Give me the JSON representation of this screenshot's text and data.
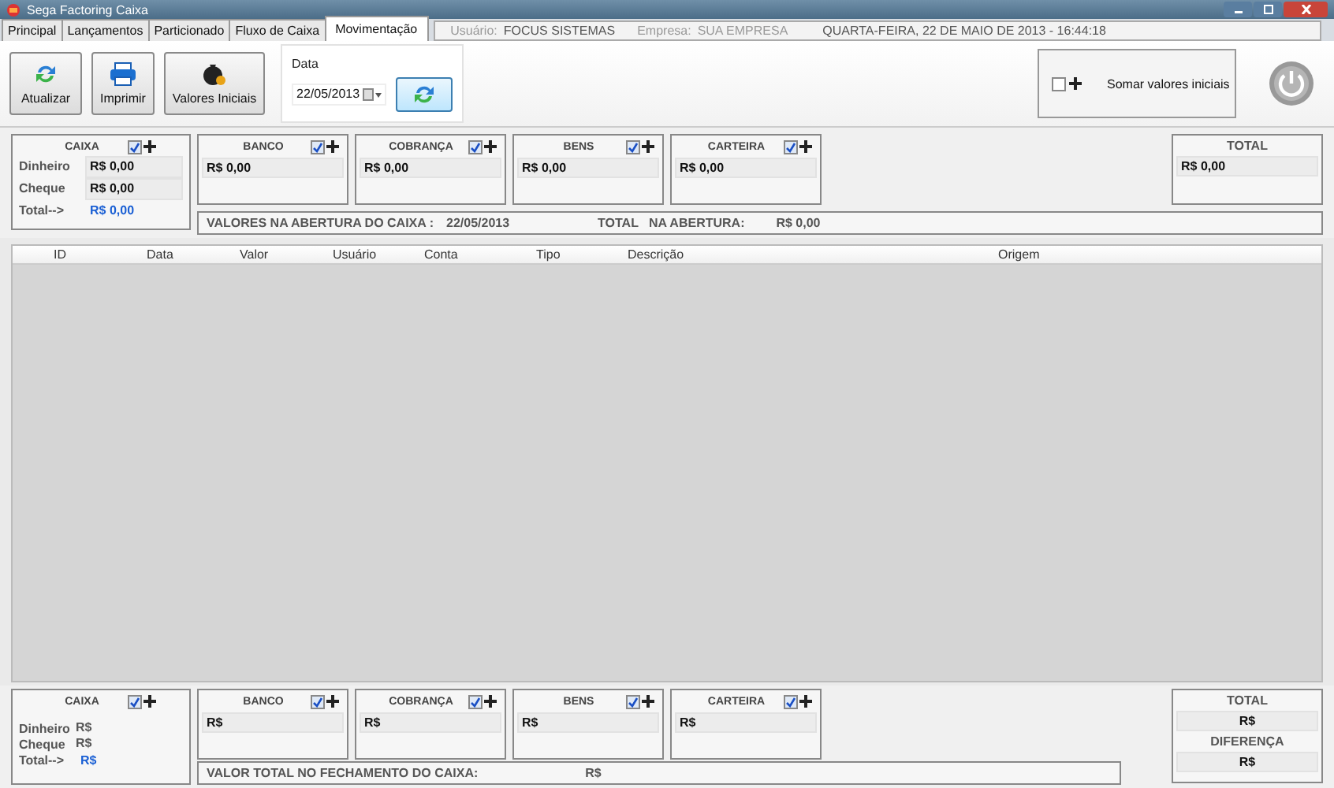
{
  "window": {
    "title": "Sega Factoring Caixa"
  },
  "tabs": [
    {
      "label": "Principal",
      "selected": false
    },
    {
      "label": "Lançamentos",
      "selected": false
    },
    {
      "label": "Particionado",
      "selected": false
    },
    {
      "label": "Fluxo de Caixa",
      "selected": false
    },
    {
      "label": "Movimentação",
      "selected": true
    }
  ],
  "session": {
    "user_label": "Usuário:",
    "user": "FOCUS SISTEMAS",
    "company_label": "Empresa:",
    "company": "SUA EMPRESA",
    "datetime": "QUARTA-FEIRA, 22 DE MAIO DE 2013 - 16:44:18"
  },
  "toolbar": [
    {
      "kind": "refresh",
      "label": "Atualizar"
    },
    {
      "kind": "print",
      "label": "Imprimir"
    },
    {
      "kind": "values",
      "label": "Valores Iniciais"
    }
  ],
  "date_filter": {
    "label": "Data",
    "value": "22/05/2013"
  },
  "sum_initial": {
    "checked": false,
    "label": "Somar valores iniciais"
  },
  "opening": {
    "caixa": {
      "title": "CAIXA",
      "checked": true,
      "rows": [
        {
          "label": "Dinheiro",
          "value": "R$ 0,00"
        },
        {
          "label": "Cheque",
          "value": "R$ 0,00"
        }
      ],
      "total_label": "Total-->",
      "total_value": "R$ 0,00"
    },
    "accounts": [
      {
        "title": "BANCO",
        "checked": true,
        "value": "R$ 0,00"
      },
      {
        "title": "COBRANÇA",
        "checked": true,
        "value": "R$ 0,00"
      },
      {
        "title": "BENS",
        "checked": true,
        "value": "R$ 0,00"
      },
      {
        "title": "CARTEIRA",
        "checked": true,
        "value": "R$ 0,00"
      }
    ],
    "totals": [
      {
        "title": "TOTAL",
        "value": "R$ 0,00"
      }
    ],
    "summary": [
      {
        "kind": "label",
        "text": "VALORES NA ABERTURA DO CAIXA :"
      },
      {
        "kind": "date",
        "text": "22/05/2013"
      },
      {
        "kind": "label",
        "text": "TOTAL   NA ABERTURA:"
      },
      {
        "kind": "value",
        "text": "R$ 0,00"
      }
    ]
  },
  "table": {
    "columns": [
      "ID",
      "Data",
      "Valor",
      "Usuário",
      "Conta",
      "Tipo",
      "Descrição",
      "Origem"
    ]
  },
  "closing": {
    "caixa": {
      "title": "CAIXA",
      "checked": true,
      "rows": [
        {
          "label": "Dinheiro",
          "value": "R$"
        },
        {
          "label": "Cheque",
          "value": "R$"
        }
      ],
      "total_label": "Total-->",
      "total_value": "R$"
    },
    "accounts": [
      {
        "title": "BANCO",
        "checked": true,
        "value": "R$"
      },
      {
        "title": "COBRANÇA",
        "checked": true,
        "value": "R$"
      },
      {
        "title": "BENS",
        "checked": true,
        "value": "R$"
      },
      {
        "title": "CARTEIRA",
        "checked": true,
        "value": "R$"
      }
    ],
    "totals": [
      {
        "title": "TOTAL",
        "value": "R$"
      },
      {
        "title": "DIFERENÇA",
        "value": "R$"
      }
    ],
    "summary": [
      {
        "kind": "label",
        "text": "VALOR TOTAL NO FECHAMENTO DO CAIXA:"
      },
      {
        "kind": "value",
        "text": "R$"
      }
    ]
  }
}
